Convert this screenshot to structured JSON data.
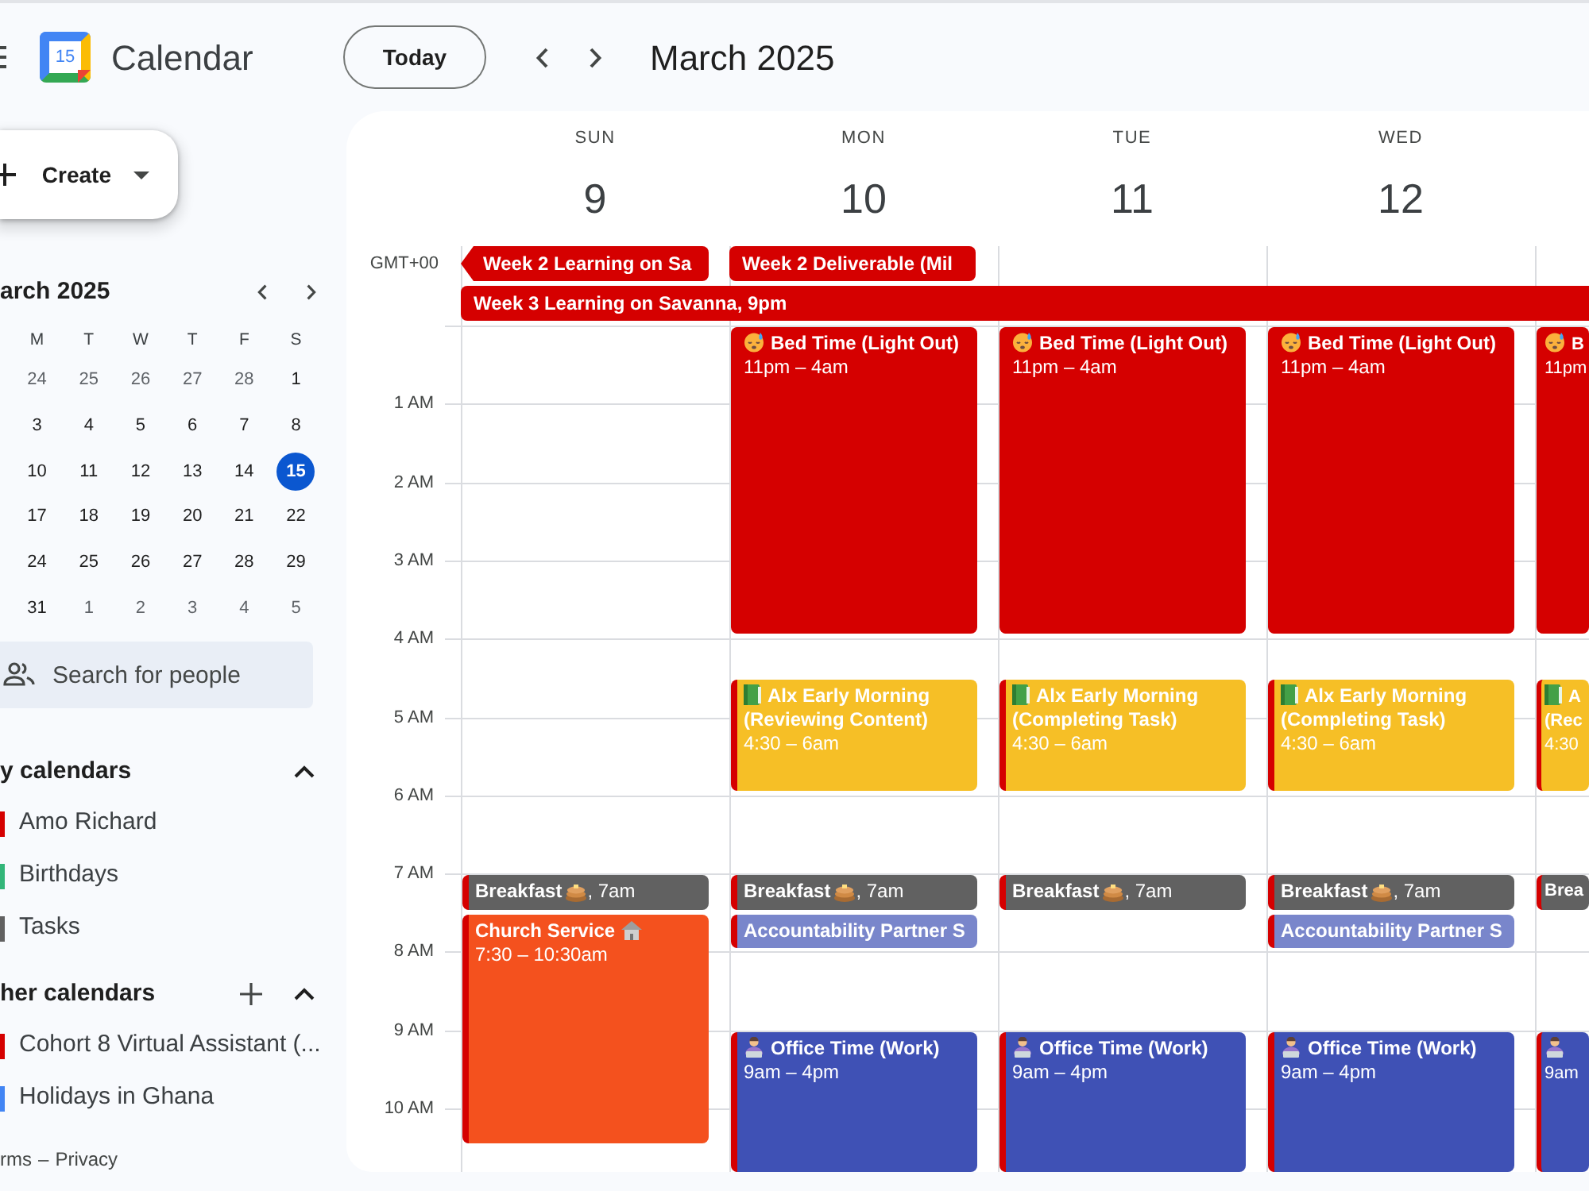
{
  "topbar": {
    "logo_day": "15",
    "app_name": "Calendar",
    "today_button": "Today",
    "period": "March 2025"
  },
  "sidebar": {
    "create_button": "Create",
    "mini_calendar": {
      "title": "arch 2025",
      "weekdays": [
        "M",
        "T",
        "W",
        "T",
        "F",
        "S"
      ],
      "weeks": [
        [
          {
            "day": "24",
            "other_month": true,
            "selected": false
          },
          {
            "day": "25",
            "other_month": true,
            "selected": false
          },
          {
            "day": "26",
            "other_month": true,
            "selected": false
          },
          {
            "day": "27",
            "other_month": true,
            "selected": false
          },
          {
            "day": "28",
            "other_month": true,
            "selected": false
          },
          {
            "day": "1",
            "other_month": false,
            "selected": false
          }
        ],
        [
          {
            "day": "3",
            "other_month": false,
            "selected": false
          },
          {
            "day": "4",
            "other_month": false,
            "selected": false
          },
          {
            "day": "5",
            "other_month": false,
            "selected": false
          },
          {
            "day": "6",
            "other_month": false,
            "selected": false
          },
          {
            "day": "7",
            "other_month": false,
            "selected": false
          },
          {
            "day": "8",
            "other_month": false,
            "selected": false
          }
        ],
        [
          {
            "day": "10",
            "other_month": false,
            "selected": false
          },
          {
            "day": "11",
            "other_month": false,
            "selected": false
          },
          {
            "day": "12",
            "other_month": false,
            "selected": false
          },
          {
            "day": "13",
            "other_month": false,
            "selected": false
          },
          {
            "day": "14",
            "other_month": false,
            "selected": false
          },
          {
            "day": "15",
            "other_month": false,
            "selected": true
          }
        ],
        [
          {
            "day": "17",
            "other_month": false,
            "selected": false
          },
          {
            "day": "18",
            "other_month": false,
            "selected": false
          },
          {
            "day": "19",
            "other_month": false,
            "selected": false
          },
          {
            "day": "20",
            "other_month": false,
            "selected": false
          },
          {
            "day": "21",
            "other_month": false,
            "selected": false
          },
          {
            "day": "22",
            "other_month": false,
            "selected": false
          }
        ],
        [
          {
            "day": "24",
            "other_month": false,
            "selected": false
          },
          {
            "day": "25",
            "other_month": false,
            "selected": false
          },
          {
            "day": "26",
            "other_month": false,
            "selected": false
          },
          {
            "day": "27",
            "other_month": false,
            "selected": false
          },
          {
            "day": "28",
            "other_month": false,
            "selected": false
          },
          {
            "day": "29",
            "other_month": false,
            "selected": false
          }
        ],
        [
          {
            "day": "31",
            "other_month": false,
            "selected": false
          },
          {
            "day": "1",
            "other_month": true,
            "selected": false
          },
          {
            "day": "2",
            "other_month": true,
            "selected": false
          },
          {
            "day": "3",
            "other_month": true,
            "selected": false
          },
          {
            "day": "4",
            "other_month": true,
            "selected": false
          },
          {
            "day": "5",
            "other_month": true,
            "selected": false
          }
        ]
      ]
    },
    "people_search": {
      "placeholder": "Search for people"
    },
    "my_calendars": {
      "title": "y calendars",
      "expanded": true,
      "items": [
        {
          "name": "Amo Richard",
          "color": "#d50000"
        },
        {
          "name": "Birthdays",
          "color": "#33b679"
        },
        {
          "name": "Tasks",
          "color": "#616161"
        }
      ]
    },
    "other_calendars": {
      "title": "her calendars",
      "expanded": true,
      "items": [
        {
          "name": "Cohort 8 Virtual Assistant (...",
          "color": "#d50000"
        },
        {
          "name": "Holidays in Ghana",
          "color": "#4285f4"
        }
      ]
    },
    "footer": {
      "links": [
        "rms",
        "Privacy"
      ],
      "separator": "–"
    }
  },
  "week_view": {
    "timezone": "GMT+00",
    "all_day": [
      {
        "title": "Week 2 Learning on Sa",
        "continues": true
      },
      {
        "title": "Week 2 Deliverable (Mil",
        "continues": false
      },
      {
        "title": "Week 3 Learning on Savanna, 9pm",
        "continues": false
      }
    ],
    "hours": [
      "1 AM",
      "2 AM",
      "3 AM",
      "4 AM",
      "5 AM",
      "6 AM",
      "7 AM",
      "8 AM",
      "9 AM",
      "10 AM"
    ],
    "days": [
      {
        "name": "SUN",
        "number": "9",
        "events": [
          {
            "kind": "meal",
            "title": "Breakfast",
            "time": ", 7am",
            "color": "#616161",
            "icon": true
          },
          {
            "kind": "worship",
            "title": "Church Service",
            "time": "7:30 – 10:30am",
            "color": "#f4511e",
            "icon": true
          }
        ]
      },
      {
        "name": "MON",
        "number": "10",
        "events": [
          {
            "kind": "sleep",
            "title": "Bed Time (Light Out)",
            "time": "11pm – 4am",
            "color": "#d50000",
            "icon": true
          },
          {
            "kind": "study",
            "title": "Alx Early Morning",
            "detail": "(Reviewing Content)",
            "time": "4:30 – 6am",
            "color": "#f6bf26",
            "icon": true
          },
          {
            "kind": "meal",
            "title": "Breakfast",
            "time": ", 7am",
            "color": "#616161",
            "icon": true
          },
          {
            "kind": "sync",
            "title": "Accountability Partner S",
            "color": "#7986cb"
          },
          {
            "kind": "work",
            "title": "Office Time (Work)",
            "time": "9am – 4pm",
            "color": "#3f51b5",
            "icon": true
          }
        ]
      },
      {
        "name": "TUE",
        "number": "11",
        "events": [
          {
            "kind": "sleep",
            "title": "Bed Time (Light Out)",
            "time": "11pm – 4am",
            "color": "#d50000",
            "icon": true
          },
          {
            "kind": "study",
            "title": "Alx Early Morning",
            "detail": "(Completing Task)",
            "time": "4:30 – 6am",
            "color": "#f6bf26",
            "icon": true
          },
          {
            "kind": "meal",
            "title": "Breakfast",
            "time": ", 7am",
            "color": "#616161",
            "icon": true
          },
          {
            "kind": "work",
            "title": "Office Time (Work)",
            "time": "9am – 4pm",
            "color": "#3f51b5",
            "icon": true
          }
        ]
      },
      {
        "name": "WED",
        "number": "12",
        "events": [
          {
            "kind": "sleep",
            "title": "Bed Time (Light Out)",
            "time": "11pm – 4am",
            "color": "#d50000",
            "icon": true
          },
          {
            "kind": "study",
            "title": "Alx Early Morning",
            "detail": "(Completing Task)",
            "time": "4:30 – 6am",
            "color": "#f6bf26",
            "icon": true
          },
          {
            "kind": "meal",
            "title": "Breakfast",
            "time": ", 7am",
            "color": "#616161",
            "icon": true
          },
          {
            "kind": "sync",
            "title": "Accountability Partner S",
            "color": "#7986cb"
          },
          {
            "kind": "work",
            "title": "Office Time (Work)",
            "time": "9am – 4pm",
            "color": "#3f51b5",
            "icon": true
          }
        ]
      },
      {
        "events": [
          {
            "kind": "sleep",
            "title": "B",
            "time": "11pm",
            "color": "#d50000",
            "icon": true
          },
          {
            "kind": "study",
            "title": "A",
            "detail": "(Rec",
            "time": "4:30",
            "color": "#f6bf26",
            "icon": true
          },
          {
            "kind": "meal",
            "title": "Brea",
            "color": "#616161"
          },
          {
            "kind": "work",
            "time": "9am",
            "color": "#3f51b5",
            "icon": true
          }
        ]
      }
    ]
  }
}
